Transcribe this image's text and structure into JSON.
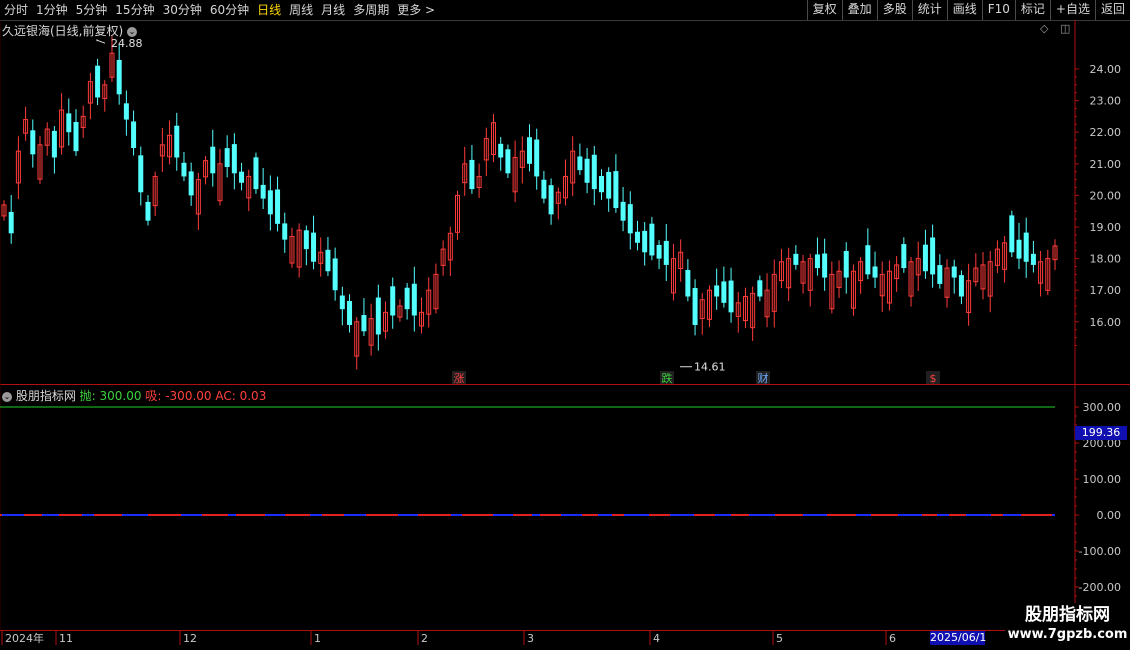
{
  "toolbar": {
    "periods": [
      "分时",
      "1分钟",
      "5分钟",
      "15分钟",
      "30分钟",
      "60分钟",
      "日线",
      "周线",
      "月线",
      "多周期",
      "更多 >"
    ],
    "active_period": "日线",
    "actions": [
      "复权",
      "叠加",
      "多股",
      "统计",
      "画线",
      "F10",
      "标记",
      "+自选",
      "返回"
    ]
  },
  "main_chart": {
    "title": "久远银海(日线,前复权)",
    "price_axis": [
      "24.00",
      "23.00",
      "22.00",
      "21.00",
      "20.00",
      "19.00",
      "18.00",
      "17.00",
      "16.00"
    ],
    "high_label": "24.88",
    "low_label": "14.61",
    "markers": [
      {
        "text": "涨",
        "color": "#ff4040"
      },
      {
        "text": "跌",
        "color": "#3cd23c"
      },
      {
        "text": "财",
        "color": "#6fa8ff"
      },
      {
        "text": "$",
        "color": "#ff4040"
      }
    ],
    "colors": {
      "up": "#ff3b3b",
      "down": "#54ffff",
      "border": "#b01010"
    }
  },
  "indicator": {
    "name": "股朋指标网",
    "line1_label": "抛: 300.00",
    "line2_label": "吸: -300.00",
    "line3_label": "AC: 0.03",
    "value_box": "199.36",
    "axis": [
      "300.00",
      "200.00",
      "100.00",
      "0.00",
      "-100.00",
      "-200.00"
    ],
    "colors": {
      "sell_line": "#1fd21f",
      "zero_red": "#e02020",
      "zero_blue": "#1a2cff"
    }
  },
  "time_axis": {
    "labels": [
      "2024年",
      "11",
      "12",
      "1",
      "2",
      "3",
      "4",
      "5",
      "6"
    ],
    "current_date": "2025/06/1"
  },
  "watermark": {
    "line1": "股朋指标网",
    "line2": "www.7gpzb.com"
  }
}
